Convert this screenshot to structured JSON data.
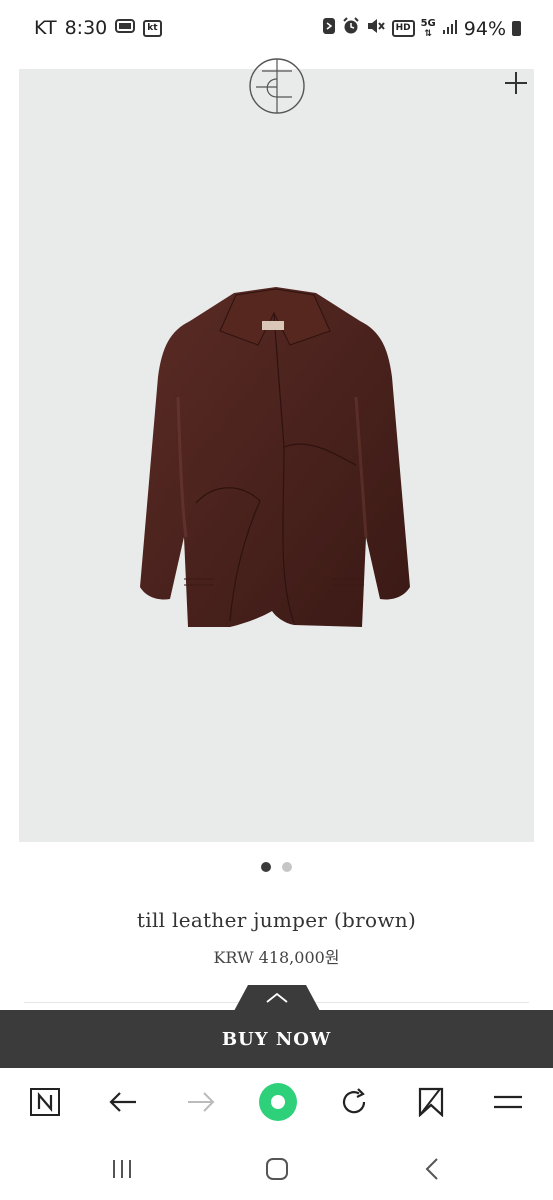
{
  "status_bar": {
    "carrier": "KT",
    "time": "8:30",
    "carrier_badge": "kt",
    "hd_badge": "HD",
    "network": "5G",
    "battery": "94%"
  },
  "product": {
    "name": "till leather jumper (brown)",
    "price": "KRW 418,000원",
    "image_count": 2,
    "active_image": 1,
    "jacket_color": "#4a221d"
  },
  "buy_bar": {
    "label": "BUY NOW",
    "color": "#3b3b3b"
  },
  "browser_toolbar": {
    "icons": [
      "naver-icon",
      "back-arrow-icon",
      "forward-arrow-icon",
      "green-dot-icon",
      "refresh-icon",
      "bookmark-icon",
      "menu-icon"
    ],
    "accent": "#2fd07a"
  },
  "nav_bar": {
    "icons": [
      "recent-apps-icon",
      "home-icon",
      "back-icon"
    ]
  }
}
